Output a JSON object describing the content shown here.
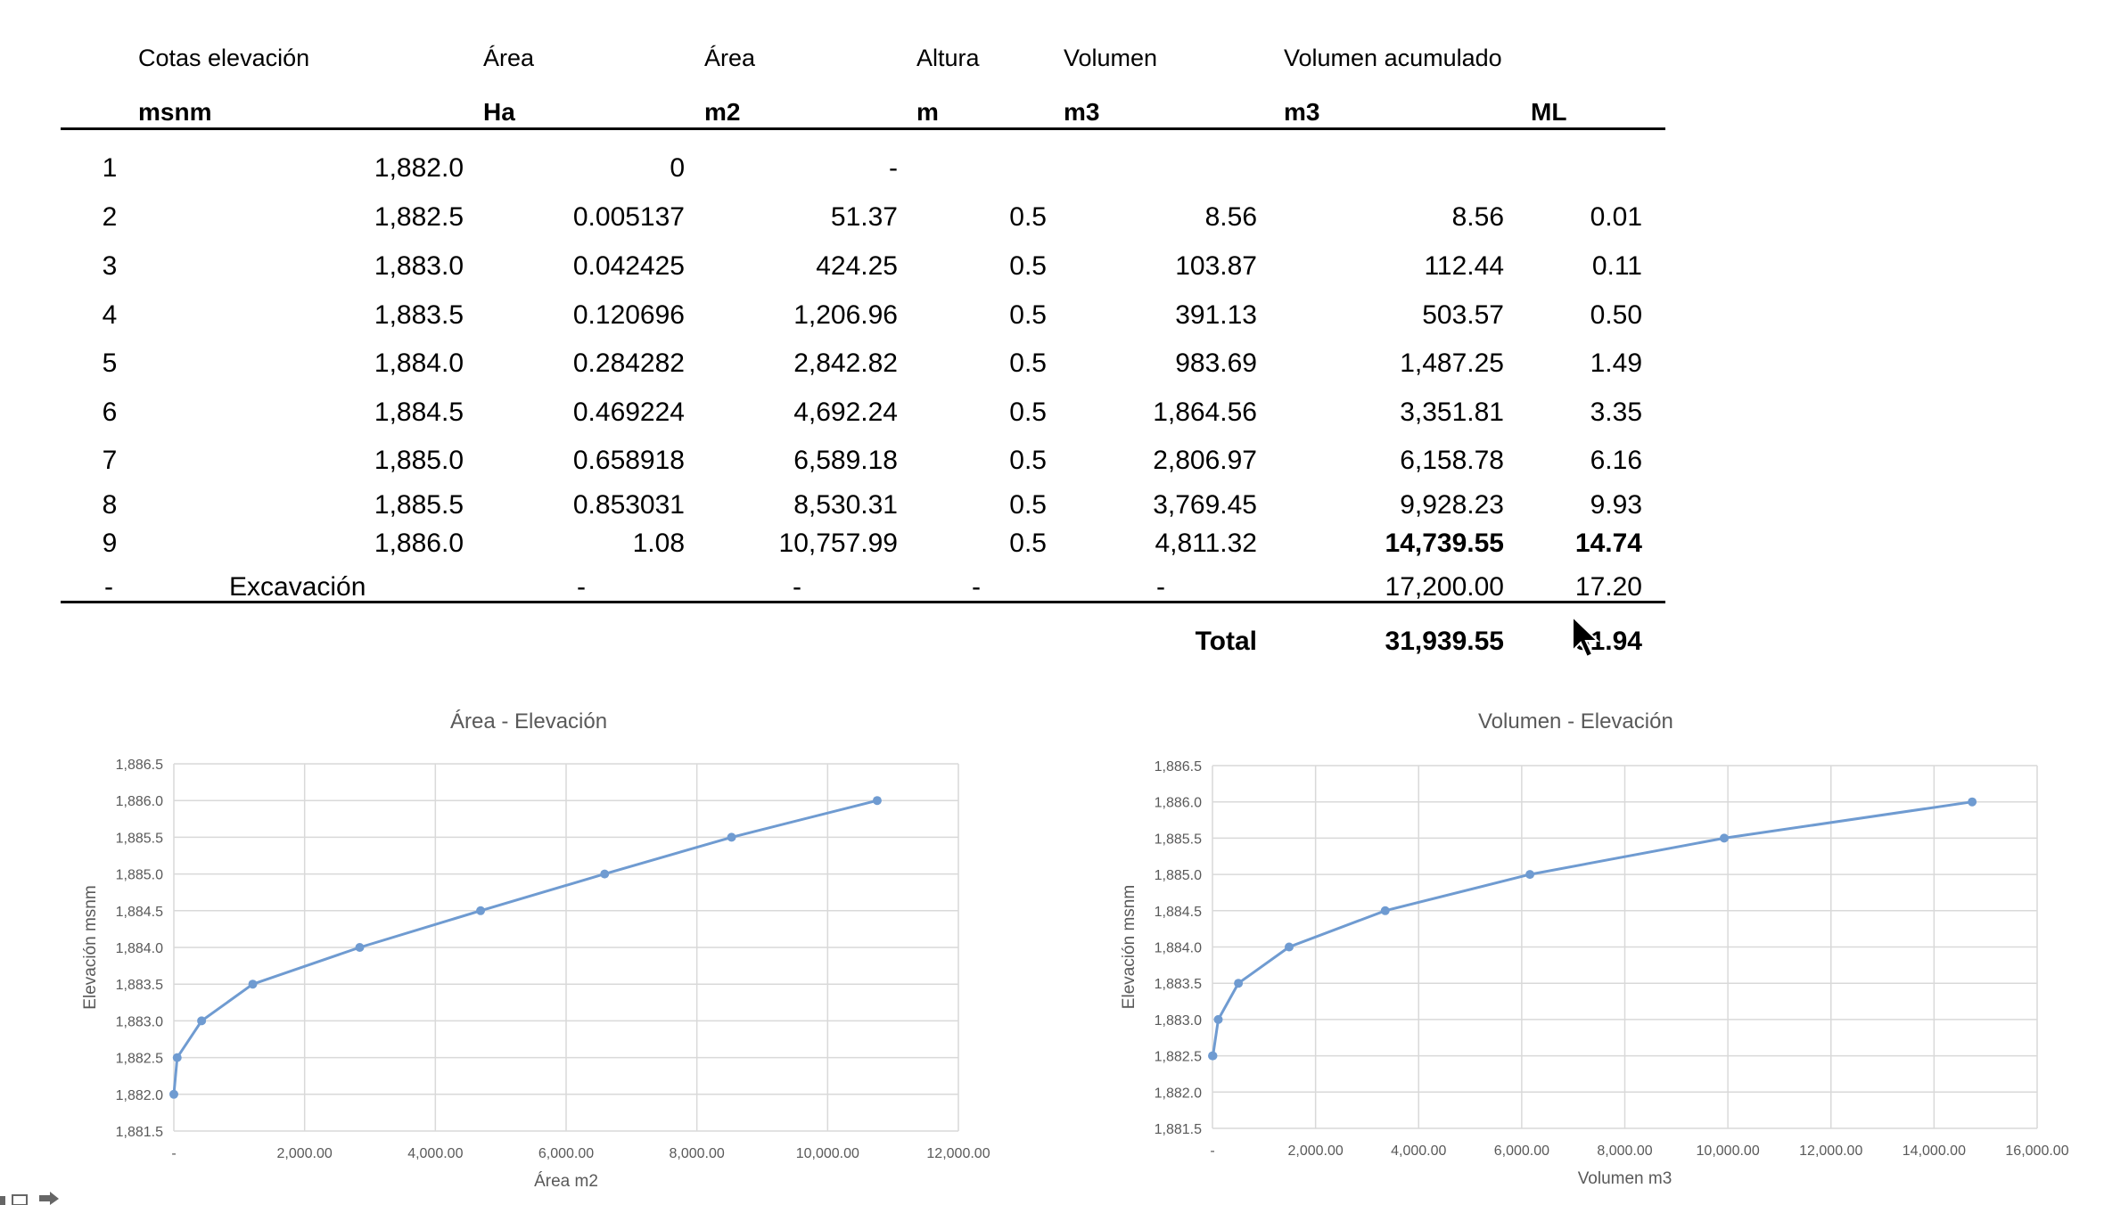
{
  "table": {
    "headers_row1": [
      "Cotas elevación",
      "Área",
      "Área",
      "Altura",
      "Volumen",
      "Volumen acumulado"
    ],
    "headers_row2": [
      "msnm",
      "Ha",
      "m2",
      "m",
      "m3",
      "m3",
      "ML"
    ],
    "rows": [
      {
        "n": "1",
        "cota": "1,882.0",
        "ha": "0",
        "m2": "-",
        "altura": "",
        "vol": "",
        "acum": "",
        "ml": ""
      },
      {
        "n": "2",
        "cota": "1,882.5",
        "ha": "0.005137",
        "m2": "51.37",
        "altura": "0.5",
        "vol": "8.56",
        "acum": "8.56",
        "ml": "0.01"
      },
      {
        "n": "3",
        "cota": "1,883.0",
        "ha": "0.042425",
        "m2": "424.25",
        "altura": "0.5",
        "vol": "103.87",
        "acum": "112.44",
        "ml": "0.11"
      },
      {
        "n": "4",
        "cota": "1,883.5",
        "ha": "0.120696",
        "m2": "1,206.96",
        "altura": "0.5",
        "vol": "391.13",
        "acum": "503.57",
        "ml": "0.50"
      },
      {
        "n": "5",
        "cota": "1,884.0",
        "ha": "0.284282",
        "m2": "2,842.82",
        "altura": "0.5",
        "vol": "983.69",
        "acum": "1,487.25",
        "ml": "1.49"
      },
      {
        "n": "6",
        "cota": "1,884.5",
        "ha": "0.469224",
        "m2": "4,692.24",
        "altura": "0.5",
        "vol": "1,864.56",
        "acum": "3,351.81",
        "ml": "3.35"
      },
      {
        "n": "7",
        "cota": "1,885.0",
        "ha": "0.658918",
        "m2": "6,589.18",
        "altura": "0.5",
        "vol": "2,806.97",
        "acum": "6,158.78",
        "ml": "6.16"
      },
      {
        "n": "8",
        "cota": "1,885.5",
        "ha": "0.853031",
        "m2": "8,530.31",
        "altura": "0.5",
        "vol": "3,769.45",
        "acum": "9,928.23",
        "ml": "9.93"
      },
      {
        "n": "9",
        "cota": "1,886.0",
        "ha": "1.08",
        "m2": "10,757.99",
        "altura": "0.5",
        "vol": "4,811.32",
        "acum": "14,739.55",
        "ml": "14.74"
      }
    ],
    "excavacion": {
      "n": "-",
      "label": "Excavación",
      "ha": "-",
      "m2": "-",
      "altura": "-",
      "vol": "-",
      "acum": "17,200.00",
      "ml": "17.20"
    },
    "total": {
      "label": "Total",
      "acum": "31,939.55",
      "ml": "31.94"
    }
  },
  "chart_data": [
    {
      "type": "line",
      "title": "Área - Elevación",
      "xlabel": "Área m2",
      "ylabel": "Elevación msnm",
      "xlim": [
        0,
        12000
      ],
      "ylim": [
        1881.5,
        1886.5
      ],
      "x_ticks": [
        "-",
        "2,000.00",
        "4,000.00",
        "6,000.00",
        "8,000.00",
        "10,000.00",
        "12,000.00"
      ],
      "y_ticks": [
        "1,881.5",
        "1,882.0",
        "1,882.5",
        "1,883.0",
        "1,883.5",
        "1,884.0",
        "1,884.5",
        "1,885.0",
        "1,885.5",
        "1,886.0",
        "1,886.5"
      ],
      "x": [
        0,
        51.37,
        424.25,
        1206.96,
        2842.82,
        4692.24,
        6589.18,
        8530.31,
        10757.99
      ],
      "y": [
        1882.0,
        1882.5,
        1883.0,
        1883.5,
        1884.0,
        1884.5,
        1885.0,
        1885.5,
        1886.0
      ],
      "grid": true,
      "color": "#6f9bd1"
    },
    {
      "type": "line",
      "title": "Volumen - Elevación",
      "xlabel": "Volumen m3",
      "ylabel": "Elevación msnm",
      "xlim": [
        0,
        16000
      ],
      "ylim": [
        1881.5,
        1886.5
      ],
      "x_ticks": [
        "-",
        "2,000.00",
        "4,000.00",
        "6,000.00",
        "8,000.00",
        "10,000.00",
        "12,000.00",
        "14,000.00",
        "16,000.00"
      ],
      "y_ticks": [
        "1,881.5",
        "1,882.0",
        "1,882.5",
        "1,883.0",
        "1,883.5",
        "1,884.0",
        "1,884.5",
        "1,885.0",
        "1,885.5",
        "1,886.0",
        "1,886.5"
      ],
      "x": [
        0,
        8.56,
        112.44,
        503.57,
        1487.25,
        3351.81,
        6158.78,
        9928.23,
        14739.55
      ],
      "y": [
        1882.5,
        1882.5,
        1883.0,
        1883.5,
        1884.0,
        1884.5,
        1885.0,
        1885.5,
        1886.0
      ],
      "grid": true,
      "color": "#6f9bd1"
    }
  ]
}
